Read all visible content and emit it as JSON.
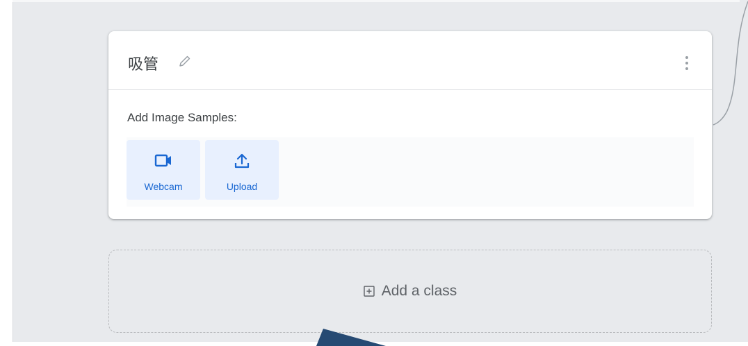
{
  "class_card": {
    "name": "吸管",
    "samples_label": "Add Image Samples:",
    "buttons": [
      {
        "label": "Webcam",
        "icon": "videocam-icon"
      },
      {
        "label": "Upload",
        "icon": "upload-icon"
      }
    ]
  },
  "add_class": {
    "label": "Add a class",
    "icon": "plus-box-icon"
  },
  "colors": {
    "workspace_bg": "#e8eaed",
    "card_bg": "#ffffff",
    "accent_blue": "#1967d2",
    "button_bg": "#e8f0fe",
    "text_dark": "#3c4043",
    "text_muted": "#5f6368",
    "arrow": "#264a73"
  }
}
